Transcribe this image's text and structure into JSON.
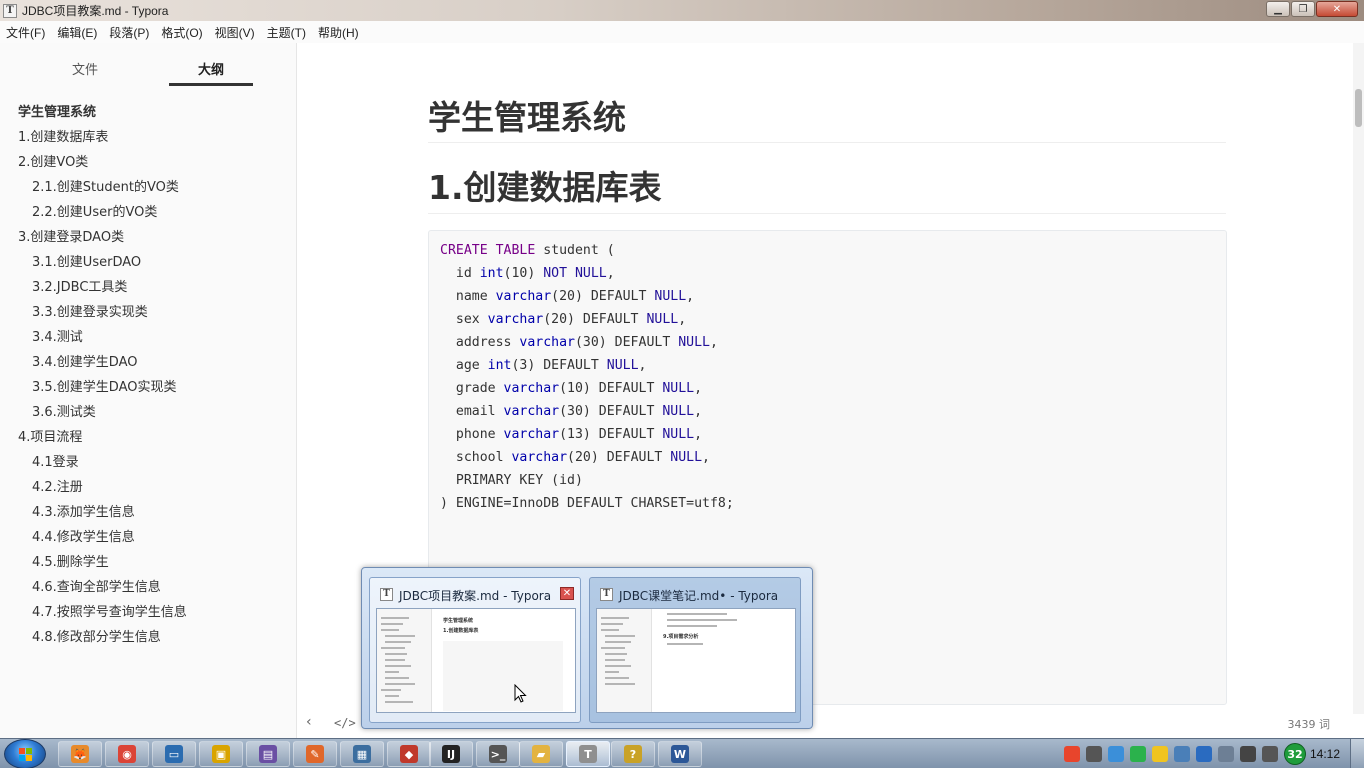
{
  "window": {
    "title": "JDBC项目教案.md - Typora",
    "app_icon_letter": "T",
    "min_symbol": "▁",
    "max_symbol": "❐",
    "close_symbol": "✕"
  },
  "menu": [
    {
      "label": "文件(F)"
    },
    {
      "label": "编辑(E)"
    },
    {
      "label": "段落(P)"
    },
    {
      "label": "格式(O)"
    },
    {
      "label": "视图(V)"
    },
    {
      "label": "主题(T)"
    },
    {
      "label": "帮助(H)"
    }
  ],
  "sidebar": {
    "tabs": {
      "files": "文件",
      "outline": "大纲"
    },
    "active_tab": "outline",
    "outline": [
      {
        "label": "学生管理系统",
        "level": 1
      },
      {
        "label": "1.创建数据库表",
        "level": 2
      },
      {
        "label": "2.创建VO类",
        "level": 2
      },
      {
        "label": "2.1.创建Student的VO类",
        "level": 3
      },
      {
        "label": "2.2.创建User的VO类",
        "level": 3
      },
      {
        "label": "3.创建登录DAO类",
        "level": 2
      },
      {
        "label": "3.1.创建UserDAO",
        "level": 3
      },
      {
        "label": "3.2.JDBC工具类",
        "level": 3
      },
      {
        "label": "3.3.创建登录实现类",
        "level": 3
      },
      {
        "label": "3.4.测试",
        "level": 3
      },
      {
        "label": "3.4.创建学生DAO",
        "level": 3
      },
      {
        "label": "3.5.创建学生DAO实现类",
        "level": 3
      },
      {
        "label": "3.6.测试类",
        "level": 3
      },
      {
        "label": "4.项目流程",
        "level": 2
      },
      {
        "label": "4.1登录",
        "level": 3
      },
      {
        "label": "4.2.注册",
        "level": 3
      },
      {
        "label": "4.3.添加学生信息",
        "level": 3
      },
      {
        "label": "4.4.修改学生信息",
        "level": 3
      },
      {
        "label": "4.5.删除学生",
        "level": 3
      },
      {
        "label": "4.6.查询全部学生信息",
        "level": 3
      },
      {
        "label": "4.7.按照学号查询学生信息",
        "level": 3
      },
      {
        "label": "4.8.修改部分学生信息",
        "level": 3
      }
    ]
  },
  "document": {
    "h1": "学生管理系统",
    "h2": "1.创建数据库表",
    "code_lines": [
      [
        {
          "t": "CREATE TABLE",
          "c": "kw"
        },
        {
          "t": " student (",
          "c": ""
        }
      ],
      [
        {
          "t": "  id ",
          "c": ""
        },
        {
          "t": "int",
          "c": "ty"
        },
        {
          "t": "(10) ",
          "c": ""
        },
        {
          "t": "NOT NULL",
          "c": "atom"
        },
        {
          "t": ",",
          "c": ""
        }
      ],
      [
        {
          "t": "  name ",
          "c": ""
        },
        {
          "t": "varchar",
          "c": "ty"
        },
        {
          "t": "(20) DEFAULT ",
          "c": ""
        },
        {
          "t": "NULL",
          "c": "atom"
        },
        {
          "t": ",",
          "c": ""
        }
      ],
      [
        {
          "t": "  sex ",
          "c": ""
        },
        {
          "t": "varchar",
          "c": "ty"
        },
        {
          "t": "(20) DEFAULT ",
          "c": ""
        },
        {
          "t": "NULL",
          "c": "atom"
        },
        {
          "t": ",",
          "c": ""
        }
      ],
      [
        {
          "t": "  address ",
          "c": ""
        },
        {
          "t": "varchar",
          "c": "ty"
        },
        {
          "t": "(30) DEFAULT ",
          "c": ""
        },
        {
          "t": "NULL",
          "c": "atom"
        },
        {
          "t": ",",
          "c": ""
        }
      ],
      [
        {
          "t": "  age ",
          "c": ""
        },
        {
          "t": "int",
          "c": "ty"
        },
        {
          "t": "(3) DEFAULT ",
          "c": ""
        },
        {
          "t": "NULL",
          "c": "atom"
        },
        {
          "t": ",",
          "c": ""
        }
      ],
      [
        {
          "t": "  grade ",
          "c": ""
        },
        {
          "t": "varchar",
          "c": "ty"
        },
        {
          "t": "(10) DEFAULT ",
          "c": ""
        },
        {
          "t": "NULL",
          "c": "atom"
        },
        {
          "t": ",",
          "c": ""
        }
      ],
      [
        {
          "t": "  email ",
          "c": ""
        },
        {
          "t": "varchar",
          "c": "ty"
        },
        {
          "t": "(30) DEFAULT ",
          "c": ""
        },
        {
          "t": "NULL",
          "c": "atom"
        },
        {
          "t": ",",
          "c": ""
        }
      ],
      [
        {
          "t": "  phone ",
          "c": ""
        },
        {
          "t": "varchar",
          "c": "ty"
        },
        {
          "t": "(13) DEFAULT ",
          "c": ""
        },
        {
          "t": "NULL",
          "c": "atom"
        },
        {
          "t": ",",
          "c": ""
        }
      ],
      [
        {
          "t": "  school ",
          "c": ""
        },
        {
          "t": "varchar",
          "c": "ty"
        },
        {
          "t": "(20) DEFAULT ",
          "c": ""
        },
        {
          "t": "NULL",
          "c": "atom"
        },
        {
          "t": ",",
          "c": ""
        }
      ],
      [
        {
          "t": "  PRIMARY KEY (id)",
          "c": ""
        }
      ],
      [
        {
          "t": ") ENGINE=InnoDB DEFAULT CHARSET=utf8;",
          "c": ""
        }
      ]
    ]
  },
  "statusbar": {
    "prev_symbol": "‹",
    "source_symbol": "</>",
    "word_count": "3439 词"
  },
  "taskbar_popup": {
    "thumb1_title": "JDBC项目教案.md - Typora",
    "thumb2_title": "JDBC课堂笔记.md• - Typora",
    "thumb1_h1": "学生管理系统",
    "thumb1_h2": "1.创建数据库表",
    "thumb2_h2": "9.项目需求分析",
    "close_symbol": "✕"
  },
  "taskbar": {
    "clock": "14:12",
    "tray_badge": "32",
    "buttons": [
      {
        "name": "taskbar-explorer-fox",
        "glyph": "🦊",
        "color": "#e88a2a"
      },
      {
        "name": "taskbar-chrome",
        "glyph": "◉",
        "color": "#db4437"
      },
      {
        "name": "taskbar-computer",
        "glyph": "▭",
        "color": "#2b6cb0"
      },
      {
        "name": "taskbar-app-yellow",
        "glyph": "▣",
        "color": "#d9a400"
      },
      {
        "name": "taskbar-app-purple",
        "glyph": "▤",
        "color": "#6a4fa3"
      },
      {
        "name": "taskbar-app-orange",
        "glyph": "✎",
        "color": "#e0672a"
      },
      {
        "name": "taskbar-app-media",
        "glyph": "▦",
        "color": "#3c6e9f"
      },
      {
        "name": "taskbar-app-red",
        "glyph": "◆",
        "color": "#c0392b"
      },
      {
        "name": "taskbar-intellij",
        "glyph": "IJ",
        "color": "#222222"
      },
      {
        "name": "taskbar-terminal",
        "glyph": ">_",
        "color": "#555555"
      },
      {
        "name": "taskbar-folder",
        "glyph": "▰",
        "color": "#e3b341"
      },
      {
        "name": "taskbar-typora",
        "glyph": "T",
        "color": "#8f8f8f"
      },
      {
        "name": "taskbar-help",
        "glyph": "?",
        "color": "#c9a227"
      },
      {
        "name": "taskbar-word",
        "glyph": "W",
        "color": "#2b5797"
      }
    ]
  }
}
